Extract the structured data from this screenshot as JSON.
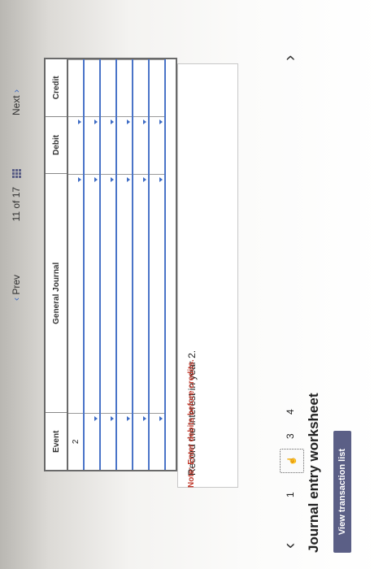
{
  "header": {
    "view_list_label": "View transaction list",
    "title": "Journal entry worksheet"
  },
  "stepper": {
    "prev_icon": "chevron-left-icon",
    "next_icon": "chevron-right-icon",
    "steps": [
      "1",
      "2",
      "3",
      "4"
    ],
    "active_step": "2"
  },
  "prompt": "Record the interest in year 2.",
  "note": "Note: Enter debits before credits.",
  "table": {
    "columns": [
      "Event",
      "General Journal",
      "Debit",
      "Credit"
    ],
    "first_event": "2"
  },
  "footer": {
    "prev_label": "Prev",
    "page_indicator": "11 of 17",
    "next_label": "Next"
  },
  "colors": {
    "accent": "#5b5f86",
    "note": "#c0392b",
    "row_rule": "#4a74c8"
  }
}
